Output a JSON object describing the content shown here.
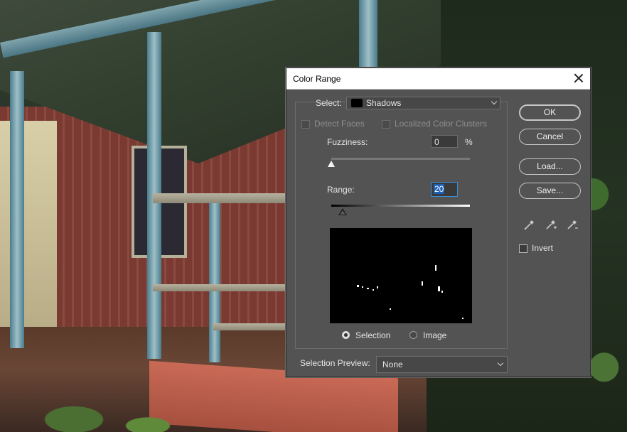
{
  "dialog": {
    "title": "Color Range",
    "select_label": "Select:",
    "select_value": "Shadows",
    "select_swatch_color": "#000000",
    "detect_faces_label": "Detect Faces",
    "localized_clusters_label": "Localized Color Clusters",
    "fuzziness_label": "Fuzziness:",
    "fuzziness_value": "0",
    "fuzziness_unit": "%",
    "fuzziness_level": 0,
    "range_label": "Range:",
    "range_value": "20",
    "range_level": 0.08,
    "radio_selection_label": "Selection",
    "radio_image_label": "Image",
    "selection_preview_label": "Selection Preview:",
    "selection_preview_value": "None",
    "invert_label": "Invert"
  },
  "buttons": {
    "ok": "OK",
    "cancel": "Cancel",
    "load": "Load...",
    "save": "Save..."
  },
  "icons": [
    "eyedropper-icon",
    "eyedropper-add-icon",
    "eyedropper-subtract-icon",
    "close-icon"
  ]
}
